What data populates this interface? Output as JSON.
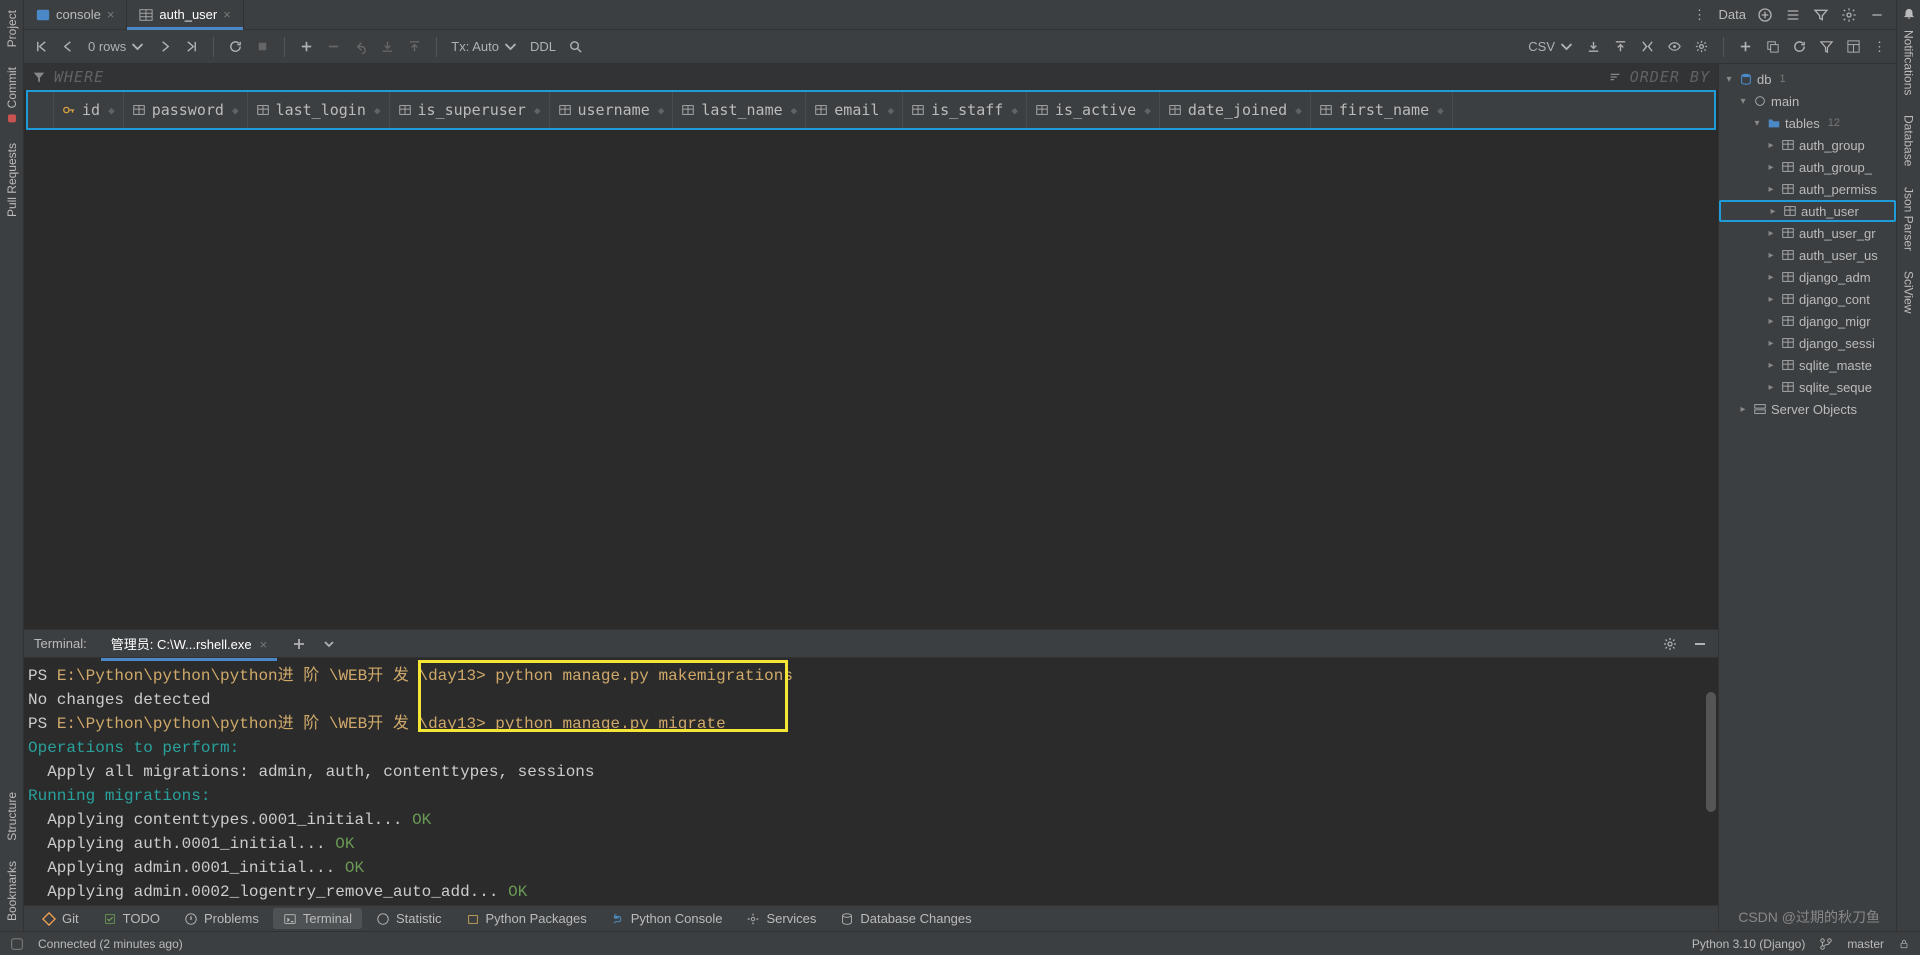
{
  "tabs": {
    "console": "console",
    "auth_user": "auth_user"
  },
  "top_right": {
    "label": "Data"
  },
  "toolbar": {
    "rows": "0 rows",
    "tx": "Tx: Auto",
    "ddl": "DDL",
    "csv": "CSV"
  },
  "filter": {
    "where": "WHERE",
    "orderby": "ORDER BY"
  },
  "columns": [
    "id",
    "password",
    "last_login",
    "is_superuser",
    "username",
    "last_name",
    "email",
    "is_staff",
    "is_active",
    "date_joined",
    "first_name"
  ],
  "db_tree": {
    "root": "db",
    "root_badge": "1",
    "schema": "main",
    "tables_label": "tables",
    "tables_count": "12",
    "tables": [
      "auth_group",
      "auth_group_",
      "auth_permiss",
      "auth_user",
      "auth_user_gr",
      "auth_user_us",
      "django_adm",
      "django_cont",
      "django_migr",
      "django_sessi",
      "sqlite_maste",
      "sqlite_seque"
    ],
    "selected": "auth_user",
    "server_objects": "Server Objects"
  },
  "terminal": {
    "label": "Terminal:",
    "tab": "管理员: C:\\W...rshell.exe",
    "lines": [
      {
        "segments": [
          {
            "t": "PS ",
            "c": "c-white"
          },
          {
            "t": "E:\\Python\\python\\python进 阶 \\WEB开 发 \\day13> ",
            "c": "c-auburn"
          },
          {
            "t": "python manage.py makemigrations",
            "c": "c-auburn"
          }
        ]
      },
      {
        "segments": [
          {
            "t": "No changes detected",
            "c": "c-white"
          }
        ]
      },
      {
        "segments": [
          {
            "t": "PS ",
            "c": "c-white"
          },
          {
            "t": "E:\\Python\\python\\python进 阶 \\WEB开 发 \\day13> ",
            "c": "c-auburn"
          },
          {
            "t": "python manage.py migrate",
            "c": "c-auburn"
          }
        ]
      },
      {
        "segments": [
          {
            "t": "Operations to perform:",
            "c": "c-teal"
          }
        ]
      },
      {
        "segments": [
          {
            "t": "  Apply all migrations: ",
            "c": "c-white"
          },
          {
            "t": "admin, auth, contenttypes, sessions",
            "c": "c-white"
          }
        ]
      },
      {
        "segments": [
          {
            "t": "Running migrations:",
            "c": "c-teal"
          }
        ]
      },
      {
        "segments": [
          {
            "t": "  Applying contenttypes.0001_initial...",
            "c": "c-white"
          },
          {
            "t": " OK",
            "c": "c-green"
          }
        ]
      },
      {
        "segments": [
          {
            "t": "  Applying auth.0001_initial...",
            "c": "c-white"
          },
          {
            "t": " OK",
            "c": "c-green"
          }
        ]
      },
      {
        "segments": [
          {
            "t": "  Applying admin.0001_initial...",
            "c": "c-white"
          },
          {
            "t": " OK",
            "c": "c-green"
          }
        ]
      },
      {
        "segments": [
          {
            "t": "  Applying admin.0002_logentry_remove_auto_add...",
            "c": "c-white"
          },
          {
            "t": " OK",
            "c": "c-green"
          }
        ]
      }
    ]
  },
  "bottom_tools": {
    "git": "Git",
    "todo": "TODO",
    "problems": "Problems",
    "terminal": "Terminal",
    "statistic": "Statistic",
    "pypkg": "Python Packages",
    "pyconsole": "Python Console",
    "services": "Services",
    "dbchanges": "Database Changes"
  },
  "status": {
    "connected": "Connected (2 minutes ago)",
    "python": "Python 3.10 (Django)",
    "branch": "master"
  },
  "left_tabs": {
    "project": "Project",
    "commit": "Commit",
    "pull": "Pull Requests",
    "structure": "Structure",
    "bookmarks": "Bookmarks"
  },
  "right_tabs": {
    "notifications": "Notifications",
    "database": "Database",
    "jsonparser": "Json Parser",
    "sciview": "SciView"
  },
  "watermark": "CSDN @过期的秋刀鱼"
}
